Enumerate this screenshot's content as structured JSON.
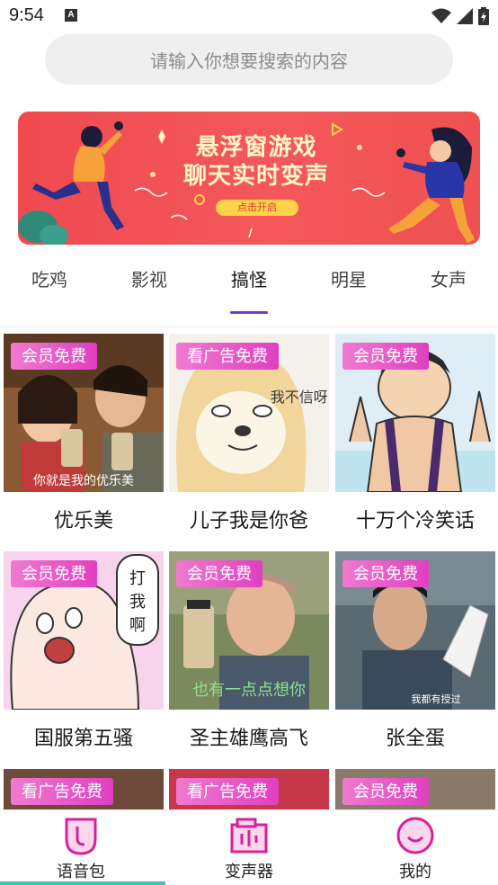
{
  "status_bar": {
    "time": "9:54",
    "notification_icon": "A"
  },
  "search": {
    "placeholder": "请输入你想要搜索的内容"
  },
  "banner": {
    "title_line1": "悬浮窗游戏",
    "title_line2": "聊天实时变声",
    "cta": "点击开启"
  },
  "tabs": [
    "吃鸡",
    "影视",
    "搞怪",
    "明星",
    "女声"
  ],
  "active_tab": "搞怪",
  "cards": [
    {
      "tag": "会员免费",
      "title": "优乐美",
      "caption": "你就是我的优乐美"
    },
    {
      "tag": "看广告免费",
      "title": "儿子我是你爸",
      "caption": "我不信呀!"
    },
    {
      "tag": "会员免费",
      "title": "十万个冷笑话",
      "caption": ""
    },
    {
      "tag": "会员免费",
      "title": "国服第五骚",
      "caption": "打我啊"
    },
    {
      "tag": "会员免费",
      "title": "圣主雄鹰高飞",
      "caption": "也有一点点想你"
    },
    {
      "tag": "会员免费",
      "title": "张全蛋",
      "caption": "我都有授过"
    },
    {
      "tag": "看广告免费",
      "title": "",
      "caption": ""
    },
    {
      "tag": "看广告免费",
      "title": "",
      "caption": ""
    },
    {
      "tag": "会员免费",
      "title": "",
      "caption": ""
    }
  ],
  "bottom_nav": [
    {
      "label": "语音包",
      "icon": "voice-pack-icon"
    },
    {
      "label": "变声器",
      "icon": "voice-changer-icon"
    },
    {
      "label": "我的",
      "icon": "profile-icon"
    }
  ],
  "colors": {
    "accent": "#6b3fd4",
    "tag_pink": "#e03fc0",
    "nav_magenta": "#d9209a",
    "banner_red": "#ef4a50"
  }
}
